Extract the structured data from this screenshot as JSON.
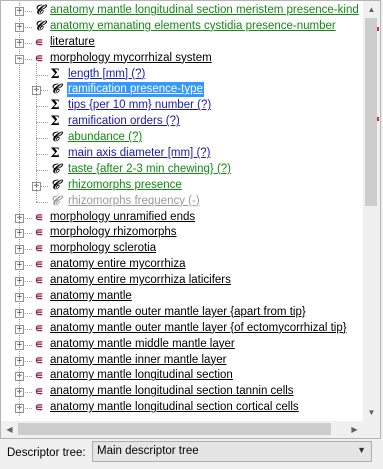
{
  "tree": [
    {
      "level": 0,
      "expander": "plus",
      "icon": "c",
      "label": "anatomy mantle longitudinal section meristem presence-kind",
      "color": "green"
    },
    {
      "level": 0,
      "expander": "plus",
      "icon": "c",
      "label": "anatomy emanating elements cystidia presence-number",
      "color": "green"
    },
    {
      "level": 0,
      "expander": "plus",
      "icon": "t",
      "label": "literature",
      "color": "black"
    },
    {
      "level": 0,
      "expander": "minus",
      "icon": "t",
      "label": "morphology mycorrhizal system",
      "color": "black"
    },
    {
      "level": 1,
      "expander": "none",
      "icon": "s",
      "label": "length [mm] (?)",
      "color": "blue"
    },
    {
      "level": 1,
      "expander": "plus",
      "icon": "c",
      "label": "ramification presence-type",
      "color": "green",
      "selected": true
    },
    {
      "level": 1,
      "expander": "none",
      "icon": "s",
      "label": "tips {per 10 mm} number (?)",
      "color": "blue"
    },
    {
      "level": 1,
      "expander": "none",
      "icon": "s",
      "label": "ramification orders (?)",
      "color": "blue"
    },
    {
      "level": 1,
      "expander": "none",
      "icon": "c",
      "label": "abundance (?)",
      "color": "green"
    },
    {
      "level": 1,
      "expander": "none",
      "icon": "s",
      "label": "main axis diameter [mm] (?)",
      "color": "blue"
    },
    {
      "level": 1,
      "expander": "none",
      "icon": "c",
      "label": "taste {after 2-3 min chewing} (?)",
      "color": "green"
    },
    {
      "level": 1,
      "expander": "plus",
      "icon": "c",
      "label": "rhizomorphs presence",
      "color": "green"
    },
    {
      "level": 1,
      "expander": "none",
      "icon": "c-grey",
      "label": "rhizomorphs frequency (-)",
      "color": "grey"
    },
    {
      "level": 0,
      "expander": "plus",
      "icon": "t",
      "label": "morphology unramified ends",
      "color": "black"
    },
    {
      "level": 0,
      "expander": "plus",
      "icon": "t",
      "label": "morphology rhizomorphs",
      "color": "black"
    },
    {
      "level": 0,
      "expander": "plus",
      "icon": "t",
      "label": "morphology sclerotia",
      "color": "black"
    },
    {
      "level": 0,
      "expander": "plus",
      "icon": "t",
      "label": "anatomy entire mycorrhiza",
      "color": "black"
    },
    {
      "level": 0,
      "expander": "plus",
      "icon": "t",
      "label": "anatomy entire mycorrhiza laticifers",
      "color": "black"
    },
    {
      "level": 0,
      "expander": "plus",
      "icon": "t",
      "label": "anatomy mantle",
      "color": "black"
    },
    {
      "level": 0,
      "expander": "plus",
      "icon": "t",
      "label": "anatomy mantle outer mantle layer {apart from tip}",
      "color": "black"
    },
    {
      "level": 0,
      "expander": "plus",
      "icon": "t",
      "label": "anatomy mantle outer mantle layer {of ectomycorrhizal tip}",
      "color": "black"
    },
    {
      "level": 0,
      "expander": "plus",
      "icon": "t",
      "label": "anatomy mantle middle mantle layer",
      "color": "black"
    },
    {
      "level": 0,
      "expander": "plus",
      "icon": "t",
      "label": "anatomy mantle inner mantle layer",
      "color": "black"
    },
    {
      "level": 0,
      "expander": "plus",
      "icon": "t",
      "label": "anatomy mantle longitudinal section",
      "color": "black"
    },
    {
      "level": 0,
      "expander": "plus",
      "icon": "t",
      "label": "anatomy mantle longitudinal section tannin cells",
      "color": "black"
    },
    {
      "level": 0,
      "expander": "plus",
      "icon": "t",
      "label": "anatomy mantle longitudinal section cortical cells",
      "color": "black"
    }
  ],
  "icons": {
    "c": "𝒞",
    "s": "Σ",
    "t": "∊"
  },
  "expander_glyphs": {
    "plus": "+",
    "minus": "−"
  },
  "colors": {
    "green": "#138a13",
    "blue": "#1a1ab0",
    "black": "#000000",
    "grey": "#9a9a9a",
    "selection": "#3399ff",
    "literature-icon": "#9b1a4b"
  },
  "footer": {
    "label": "Descriptor tree:",
    "select_value": "Main descriptor tree"
  },
  "scroll_glyphs": {
    "up": "▲",
    "down": "▼",
    "left": "◀",
    "right": "▶",
    "dropdown": "▼"
  }
}
